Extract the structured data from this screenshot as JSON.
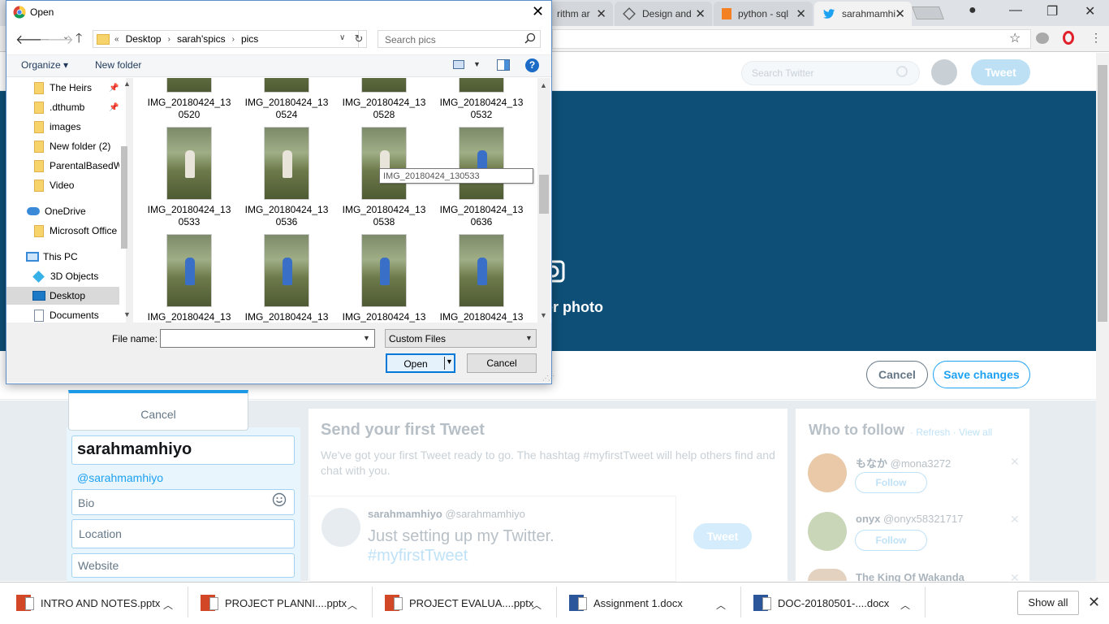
{
  "chrome": {
    "tabs": [
      {
        "label": "rithm ar",
        "active": false
      },
      {
        "label": "Design and",
        "active": false
      },
      {
        "label": "python - sql",
        "active": false
      },
      {
        "label": "sarahmamhi",
        "active": true
      }
    ]
  },
  "twitter": {
    "search_placeholder": "Search Twitter",
    "tweet_button": "Tweet",
    "banner_text": "der photo",
    "cancel_button": "Cancel",
    "save_button": "Save changes",
    "dropdown_cancel": "Cancel",
    "profile": {
      "name": "sarahmamhiyo",
      "handle": "@sarahmamhiyo",
      "bio_placeholder": "Bio",
      "location_placeholder": "Location",
      "website_placeholder": "Website"
    },
    "first_tweet": {
      "title": "Send your first Tweet",
      "description": "We've got your first Tweet ready to go. The hashtag #myfirstTweet will help others find and chat with you.",
      "user_name": "sarahmamhiyo",
      "user_handle": "@sarahmamhiyo",
      "text": "Just setting up my Twitter.",
      "hashtag": "#myfirstTweet",
      "button": "Tweet"
    },
    "who_to_follow": {
      "title": "Who to follow",
      "links": "· Refresh · View all",
      "users": [
        {
          "name": "もなか",
          "handle": "@mona3272",
          "follow": "Follow"
        },
        {
          "name": "onyx",
          "handle": "@onyx58321717",
          "follow": "Follow"
        },
        {
          "name": "The King Of Wakanda",
          "handle": "",
          "follow": ""
        }
      ]
    }
  },
  "downloads": {
    "items": [
      {
        "name": "INTRO AND NOTES.pptx",
        "type": "ppt"
      },
      {
        "name": "PROJECT PLANNI....pptx",
        "type": "ppt"
      },
      {
        "name": "PROJECT EVALUA....pptx",
        "type": "ppt"
      },
      {
        "name": "Assignment 1.docx",
        "type": "doc"
      },
      {
        "name": "DOC-20180501-....docx",
        "type": "doc"
      }
    ],
    "show_all": "Show all"
  },
  "dialog": {
    "title": "Open",
    "address": {
      "prefix": "«",
      "crumbs": [
        "Desktop",
        "sarah'spics",
        "pics"
      ]
    },
    "search_placeholder": "Search pics",
    "organize": "Organize ▾",
    "new_folder": "New folder",
    "nav": [
      {
        "label": "The Heirs",
        "icon": "folder",
        "pinned": true
      },
      {
        "label": ".dthumb",
        "icon": "folder",
        "pinned": true
      },
      {
        "label": "images",
        "icon": "folder",
        "pinned": false
      },
      {
        "label": "New folder (2)",
        "icon": "folder",
        "pinned": false
      },
      {
        "label": "ParentalBasedW",
        "icon": "folder",
        "pinned": false
      },
      {
        "label": "Video",
        "icon": "folder",
        "pinned": false
      },
      {
        "label": "OneDrive",
        "icon": "cloud",
        "pinned": false
      },
      {
        "label": "Microsoft Office",
        "icon": "folder",
        "pinned": false
      },
      {
        "label": "This PC",
        "icon": "pc",
        "pinned": false
      },
      {
        "label": "3D Objects",
        "icon": "3d",
        "pinned": false
      },
      {
        "label": "Desktop",
        "icon": "desktop",
        "pinned": false,
        "selected": true
      },
      {
        "label": "Documents",
        "icon": "documents",
        "pinned": false
      }
    ],
    "files": [
      {
        "line1": "IMG_20180424_13",
        "line2": "0520"
      },
      {
        "line1": "IMG_20180424_13",
        "line2": "0524"
      },
      {
        "line1": "IMG_20180424_13",
        "line2": "0528"
      },
      {
        "line1": "IMG_20180424_13",
        "line2": "0532"
      },
      {
        "line1": "IMG_20180424_13",
        "line2": "0533"
      },
      {
        "line1": "IMG_20180424_13",
        "line2": "0536"
      },
      {
        "line1": "IMG_20180424_13",
        "line2": "0538"
      },
      {
        "line1": "IMG_20180424_13",
        "line2": "0636"
      },
      {
        "line1": "IMG_20180424_13",
        "line2": ""
      },
      {
        "line1": "IMG_20180424_13",
        "line2": ""
      },
      {
        "line1": "IMG_20180424_13",
        "line2": ""
      },
      {
        "line1": "IMG_20180424_13",
        "line2": ""
      }
    ],
    "tooltip": "IMG_20180424_130533",
    "file_name_label": "File name:",
    "file_name_value": "",
    "file_type": "Custom Files",
    "open_button": "Open",
    "cancel_button": "Cancel"
  }
}
